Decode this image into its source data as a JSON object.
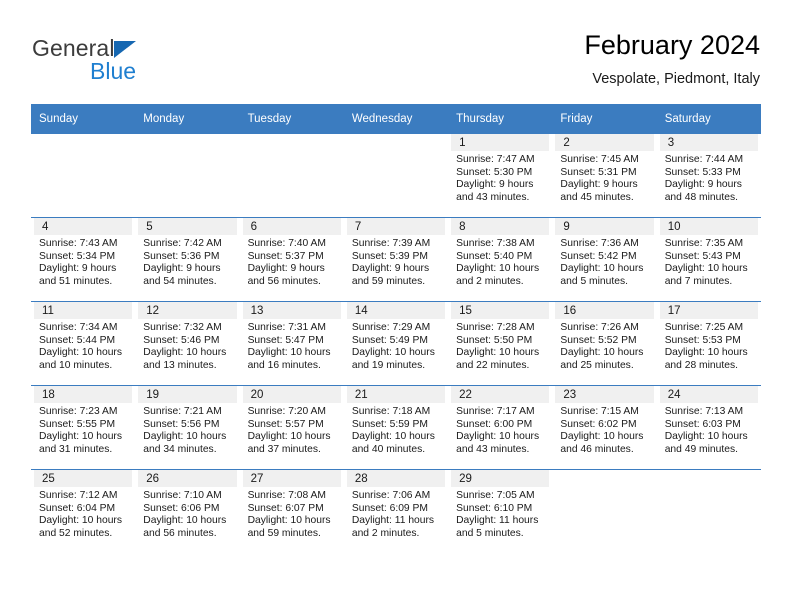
{
  "brand": {
    "name_part1": "General",
    "name_part2": "Blue",
    "logo_icon": "triangle-logo-icon",
    "colors": {
      "triangle": "#1667b1",
      "blue_text": "#1f7fd0",
      "general_text": "#3c3c3c"
    }
  },
  "header": {
    "title": "February 2024",
    "subtitle": "Vespolate, Piedmont, Italy"
  },
  "theme": {
    "header_blue": "#3b7cc0",
    "date_band": "#f0f0f0",
    "row_border": "#3b7cc0"
  },
  "weekday_headers": [
    "Sunday",
    "Monday",
    "Tuesday",
    "Wednesday",
    "Thursday",
    "Friday",
    "Saturday"
  ],
  "weeks": [
    [
      {
        "empty": true
      },
      {
        "empty": true
      },
      {
        "empty": true
      },
      {
        "empty": true
      },
      {
        "day": "1",
        "sunrise": "Sunrise: 7:47 AM",
        "sunset": "Sunset: 5:30 PM",
        "daylight_line1": "Daylight: 9 hours",
        "daylight_line2": "and 43 minutes."
      },
      {
        "day": "2",
        "sunrise": "Sunrise: 7:45 AM",
        "sunset": "Sunset: 5:31 PM",
        "daylight_line1": "Daylight: 9 hours",
        "daylight_line2": "and 45 minutes."
      },
      {
        "day": "3",
        "sunrise": "Sunrise: 7:44 AM",
        "sunset": "Sunset: 5:33 PM",
        "daylight_line1": "Daylight: 9 hours",
        "daylight_line2": "and 48 minutes."
      }
    ],
    [
      {
        "day": "4",
        "sunrise": "Sunrise: 7:43 AM",
        "sunset": "Sunset: 5:34 PM",
        "daylight_line1": "Daylight: 9 hours",
        "daylight_line2": "and 51 minutes."
      },
      {
        "day": "5",
        "sunrise": "Sunrise: 7:42 AM",
        "sunset": "Sunset: 5:36 PM",
        "daylight_line1": "Daylight: 9 hours",
        "daylight_line2": "and 54 minutes."
      },
      {
        "day": "6",
        "sunrise": "Sunrise: 7:40 AM",
        "sunset": "Sunset: 5:37 PM",
        "daylight_line1": "Daylight: 9 hours",
        "daylight_line2": "and 56 minutes."
      },
      {
        "day": "7",
        "sunrise": "Sunrise: 7:39 AM",
        "sunset": "Sunset: 5:39 PM",
        "daylight_line1": "Daylight: 9 hours",
        "daylight_line2": "and 59 minutes."
      },
      {
        "day": "8",
        "sunrise": "Sunrise: 7:38 AM",
        "sunset": "Sunset: 5:40 PM",
        "daylight_line1": "Daylight: 10 hours",
        "daylight_line2": "and 2 minutes."
      },
      {
        "day": "9",
        "sunrise": "Sunrise: 7:36 AM",
        "sunset": "Sunset: 5:42 PM",
        "daylight_line1": "Daylight: 10 hours",
        "daylight_line2": "and 5 minutes."
      },
      {
        "day": "10",
        "sunrise": "Sunrise: 7:35 AM",
        "sunset": "Sunset: 5:43 PM",
        "daylight_line1": "Daylight: 10 hours",
        "daylight_line2": "and 7 minutes."
      }
    ],
    [
      {
        "day": "11",
        "sunrise": "Sunrise: 7:34 AM",
        "sunset": "Sunset: 5:44 PM",
        "daylight_line1": "Daylight: 10 hours",
        "daylight_line2": "and 10 minutes."
      },
      {
        "day": "12",
        "sunrise": "Sunrise: 7:32 AM",
        "sunset": "Sunset: 5:46 PM",
        "daylight_line1": "Daylight: 10 hours",
        "daylight_line2": "and 13 minutes."
      },
      {
        "day": "13",
        "sunrise": "Sunrise: 7:31 AM",
        "sunset": "Sunset: 5:47 PM",
        "daylight_line1": "Daylight: 10 hours",
        "daylight_line2": "and 16 minutes."
      },
      {
        "day": "14",
        "sunrise": "Sunrise: 7:29 AM",
        "sunset": "Sunset: 5:49 PM",
        "daylight_line1": "Daylight: 10 hours",
        "daylight_line2": "and 19 minutes."
      },
      {
        "day": "15",
        "sunrise": "Sunrise: 7:28 AM",
        "sunset": "Sunset: 5:50 PM",
        "daylight_line1": "Daylight: 10 hours",
        "daylight_line2": "and 22 minutes."
      },
      {
        "day": "16",
        "sunrise": "Sunrise: 7:26 AM",
        "sunset": "Sunset: 5:52 PM",
        "daylight_line1": "Daylight: 10 hours",
        "daylight_line2": "and 25 minutes."
      },
      {
        "day": "17",
        "sunrise": "Sunrise: 7:25 AM",
        "sunset": "Sunset: 5:53 PM",
        "daylight_line1": "Daylight: 10 hours",
        "daylight_line2": "and 28 minutes."
      }
    ],
    [
      {
        "day": "18",
        "sunrise": "Sunrise: 7:23 AM",
        "sunset": "Sunset: 5:55 PM",
        "daylight_line1": "Daylight: 10 hours",
        "daylight_line2": "and 31 minutes."
      },
      {
        "day": "19",
        "sunrise": "Sunrise: 7:21 AM",
        "sunset": "Sunset: 5:56 PM",
        "daylight_line1": "Daylight: 10 hours",
        "daylight_line2": "and 34 minutes."
      },
      {
        "day": "20",
        "sunrise": "Sunrise: 7:20 AM",
        "sunset": "Sunset: 5:57 PM",
        "daylight_line1": "Daylight: 10 hours",
        "daylight_line2": "and 37 minutes."
      },
      {
        "day": "21",
        "sunrise": "Sunrise: 7:18 AM",
        "sunset": "Sunset: 5:59 PM",
        "daylight_line1": "Daylight: 10 hours",
        "daylight_line2": "and 40 minutes."
      },
      {
        "day": "22",
        "sunrise": "Sunrise: 7:17 AM",
        "sunset": "Sunset: 6:00 PM",
        "daylight_line1": "Daylight: 10 hours",
        "daylight_line2": "and 43 minutes."
      },
      {
        "day": "23",
        "sunrise": "Sunrise: 7:15 AM",
        "sunset": "Sunset: 6:02 PM",
        "daylight_line1": "Daylight: 10 hours",
        "daylight_line2": "and 46 minutes."
      },
      {
        "day": "24",
        "sunrise": "Sunrise: 7:13 AM",
        "sunset": "Sunset: 6:03 PM",
        "daylight_line1": "Daylight: 10 hours",
        "daylight_line2": "and 49 minutes."
      }
    ],
    [
      {
        "day": "25",
        "sunrise": "Sunrise: 7:12 AM",
        "sunset": "Sunset: 6:04 PM",
        "daylight_line1": "Daylight: 10 hours",
        "daylight_line2": "and 52 minutes."
      },
      {
        "day": "26",
        "sunrise": "Sunrise: 7:10 AM",
        "sunset": "Sunset: 6:06 PM",
        "daylight_line1": "Daylight: 10 hours",
        "daylight_line2": "and 56 minutes."
      },
      {
        "day": "27",
        "sunrise": "Sunrise: 7:08 AM",
        "sunset": "Sunset: 6:07 PM",
        "daylight_line1": "Daylight: 10 hours",
        "daylight_line2": "and 59 minutes."
      },
      {
        "day": "28",
        "sunrise": "Sunrise: 7:06 AM",
        "sunset": "Sunset: 6:09 PM",
        "daylight_line1": "Daylight: 11 hours",
        "daylight_line2": "and 2 minutes."
      },
      {
        "day": "29",
        "sunrise": "Sunrise: 7:05 AM",
        "sunset": "Sunset: 6:10 PM",
        "daylight_line1": "Daylight: 11 hours",
        "daylight_line2": "and 5 minutes."
      },
      {
        "empty": true
      },
      {
        "empty": true
      }
    ]
  ]
}
